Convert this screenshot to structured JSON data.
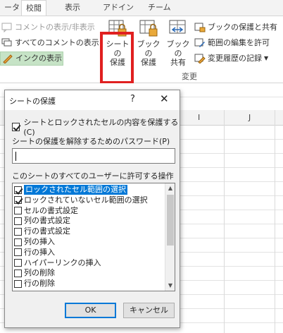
{
  "ribbon": {
    "tabs": [
      {
        "label": "ータ"
      },
      {
        "label": "校閲"
      },
      {
        "label": "表示"
      },
      {
        "label": "アドイン"
      },
      {
        "label": "チーム"
      }
    ],
    "comment_buttons": {
      "show_hide": "コメントの表示/非表示",
      "show_all": "すべてのコメントの表示",
      "show_ink": "インクの表示"
    },
    "big_buttons": {
      "protect_sheet": [
        "シートの",
        "保護"
      ],
      "protect_book": [
        "ブックの",
        "保護"
      ],
      "share_book": [
        "ブックの",
        "共有"
      ]
    },
    "small_buttons": {
      "protect_share": "ブックの保護と共有",
      "allow_edit_ranges": "範囲の編集を許可",
      "track_changes": "変更履歴の記録"
    },
    "group_label": "変更"
  },
  "grid": {
    "columns": [
      "I",
      "J"
    ]
  },
  "dialog": {
    "title": "シートの保護",
    "help": "?",
    "close": "✕",
    "protect_label": "シートとロックされたセルの内容を保護する(C)",
    "protect_checked": true,
    "password_label": "シートの保護を解除するためのパスワード(P)",
    "password_value": "",
    "ops_label": "このシートのすべてのユーザーに許可する操作(O):",
    "options": [
      {
        "label": "ロックされたセル範囲の選択",
        "checked": true,
        "selected": true
      },
      {
        "label": "ロックされていないセル範囲の選択",
        "checked": true,
        "selected": false
      },
      {
        "label": "セルの書式設定",
        "checked": false,
        "selected": false
      },
      {
        "label": "列の書式設定",
        "checked": false,
        "selected": false
      },
      {
        "label": "行の書式設定",
        "checked": false,
        "selected": false
      },
      {
        "label": "列の挿入",
        "checked": false,
        "selected": false
      },
      {
        "label": "行の挿入",
        "checked": false,
        "selected": false
      },
      {
        "label": "ハイパーリンクの挿入",
        "checked": false,
        "selected": false
      },
      {
        "label": "列の削除",
        "checked": false,
        "selected": false
      },
      {
        "label": "行の削除",
        "checked": false,
        "selected": false
      }
    ],
    "ok": "OK",
    "cancel": "キャンセル"
  }
}
